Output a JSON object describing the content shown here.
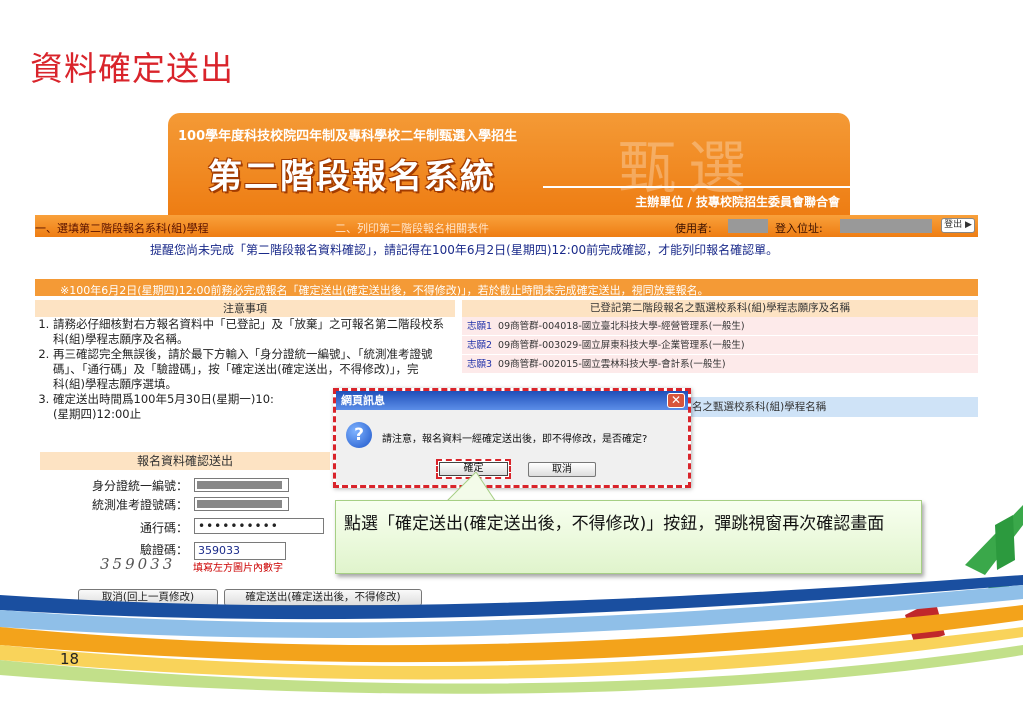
{
  "slide": {
    "title": "資料確定送出",
    "page_number": "18"
  },
  "banner": {
    "subtitle": "100學年度科技校院四年制及專科學校二年制甄選入學招生",
    "main_title": "第二階段報名系統",
    "watermark": "甄選",
    "organizer": "主辦單位 / 技專校院招生委員會聯合會"
  },
  "topbar": {
    "step1": "一、選填第二階段報名系科(組)學程",
    "step2": "二、列印第二階段報名相關表件",
    "user_label": "使用者:",
    "ip_label": "登入位址:",
    "logout_label": "登出"
  },
  "reminder": "提醒您尚未完成「第二階段報名資料確認」，請記得在100年6月2日(星期四)12:00前完成確認，才能列印報名確認單。",
  "deadline": "※100年6月2日(星期四)12:00前務必完成報名「確定送出(確定送出後，不得修改)」，若於截止時間未完成確定送出，視同放棄報名。",
  "notes": {
    "heading": "注意事項",
    "items": [
      "請務必仔細核對右方報名資料中「已登記」及「放棄」之可報名第二階段校系科(組)學程志願序及名稱。",
      "再三確認完全無誤後，請於最下方輸入「身分證統一編號」、「統測准考證號碼」、「通行碼」及「驗證碼」，按「確定送出(確定送出，不得修改)」，完",
      "確定送出時間爲100年5月30日(星期一)10:"
    ],
    "extra_line2": "科(組)學程志願序選填。",
    "extra_line3": "(星期四)12:00止"
  },
  "form": {
    "heading": "報名資料確認送出",
    "id_label": "身分證統一編號：",
    "exam_label": "統測准考證號碼：",
    "pass_label": "通行碼：",
    "pass_value": "••••••••••",
    "captcha_label": "驗證碼：",
    "captcha_value": "359033",
    "captcha_image": "359033",
    "captcha_hint": "填寫左方圖片內數字",
    "cancel_button": "取消(回上一頁修改)",
    "submit_button": "確定送出(確定送出後，不得修改)"
  },
  "registered": {
    "heading": "已登記第二階段報名之甄選校系科(組)學程志願序及名稱",
    "rows": [
      {
        "wish": "志願1",
        "text": "09商管群-004018-國立臺北科技大學-經營管理系(一般生)"
      },
      {
        "wish": "志願2",
        "text": "09商管群-003029-國立屏東科技大學-企業管理系(一般生)"
      },
      {
        "wish": "志願3",
        "text": "09商管群-002015-國立雲林科技大學-會計系(一般生)"
      }
    ],
    "abandoned_heading": "名之甄選校系科(組)學程名稱"
  },
  "dialog": {
    "title": "網頁訊息",
    "close": "✕",
    "icon": "?",
    "message": "請注意，報名資料一經確定送出後，即不得修改，是否確定?",
    "ok": "確定",
    "cancel": "取消"
  },
  "callout": "點選「確定送出(確定送出後，不得修改)」按鈕，彈跳視窗再次確認畫面",
  "colors": {
    "accent_red": "#d9242b",
    "banner_orange": "#ee7d13",
    "callout_green": "#e0f4cc"
  }
}
